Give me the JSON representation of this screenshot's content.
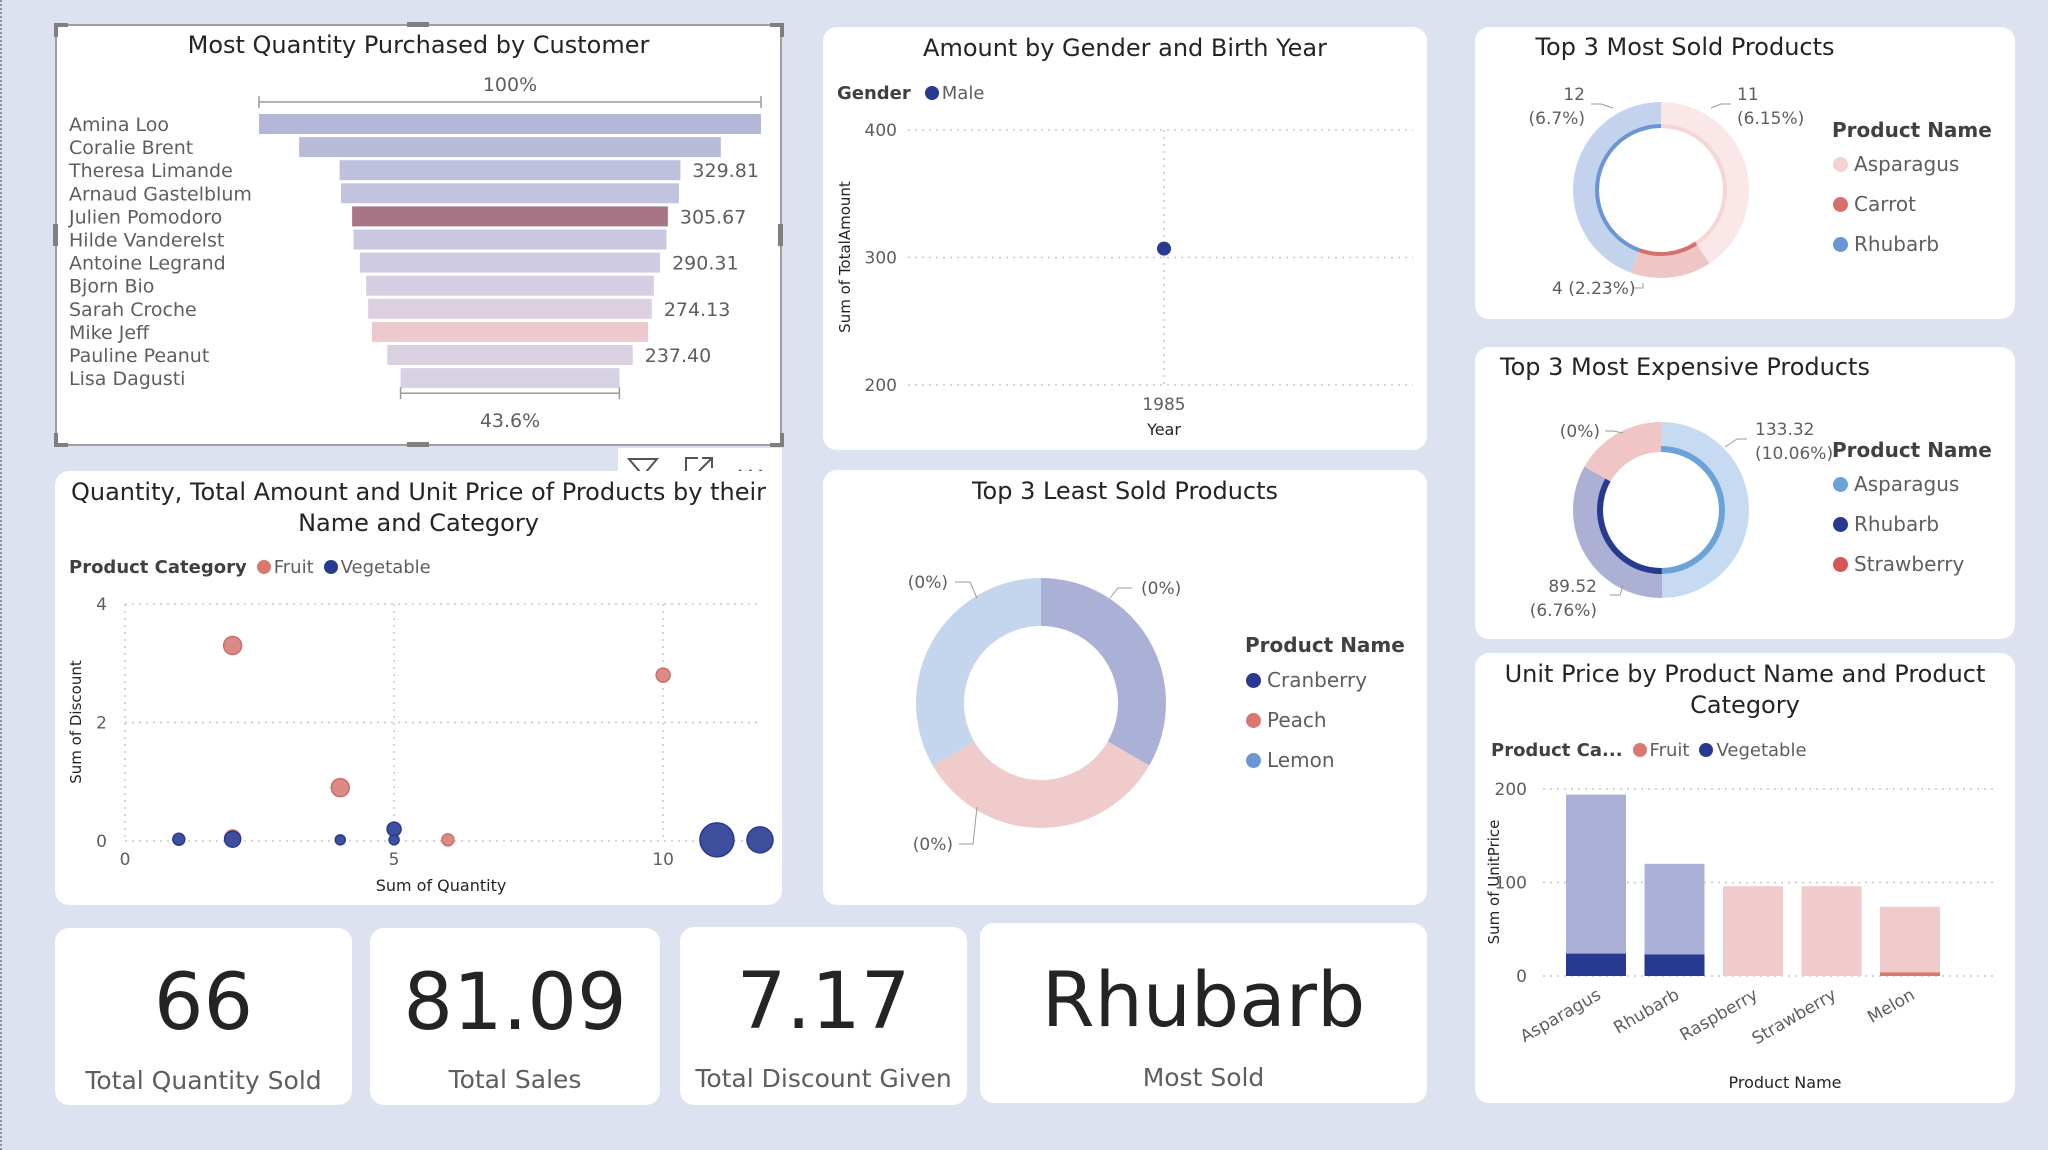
{
  "funnel": {
    "title": "Most Quantity Purchased by Customer",
    "top_pct": "100%",
    "bottom_pct": "43.6%",
    "customers": [
      {
        "name": "Amina Loo",
        "value": 100,
        "label": "",
        "color": "#b5b7d8"
      },
      {
        "name": "Coralie Brent",
        "value": 84,
        "label": "",
        "color": "#b9bbdb"
      },
      {
        "name": "Theresa Limande",
        "value": 67.9,
        "label": "329.81",
        "color": "#bec0dd"
      },
      {
        "name": "Arnaud Gastelblum",
        "value": 67.3,
        "label": "",
        "color": "#c2c3df"
      },
      {
        "name": "Julien Pomodoro",
        "value": 62.9,
        "label": "305.67",
        "color": "#a77586"
      },
      {
        "name": "Hilde Vanderelst",
        "value": 62.3,
        "label": "",
        "color": "#cac8e1"
      },
      {
        "name": "Antoine Legrand",
        "value": 59.8,
        "label": "290.31",
        "color": "#cfcbe2"
      },
      {
        "name": "Bjorn Bio",
        "value": 57.3,
        "label": "",
        "color": "#d5cde1"
      },
      {
        "name": "Sarah Croche",
        "value": 56.5,
        "label": "274.13",
        "color": "#dccfe0"
      },
      {
        "name": "Mike Jeff",
        "value": 55.0,
        "label": "",
        "color": "#ecc9cc"
      },
      {
        "name": "Pauline Peanut",
        "value": 48.9,
        "label": "237.40",
        "color": "#dad0e1"
      },
      {
        "name": "Lisa Dagusti",
        "value": 43.6,
        "label": "",
        "color": "#d6d1e3"
      }
    ]
  },
  "visual_toolbar": {
    "filter_icon": "filter-icon",
    "focus_icon": "focus-mode-icon",
    "more_icon": "more-options-icon",
    "more_text": "..."
  },
  "gender": {
    "title": "Amount by Gender and Birth Year",
    "legend_title": "Gender",
    "legend_items": [
      {
        "label": "Male",
        "color": "#273a90"
      }
    ],
    "chart_data": {
      "type": "scatter",
      "title": "Amount by Gender and Birth Year",
      "xlabel": "Year",
      "ylabel": "Sum of TotalAmount",
      "ylim": [
        200,
        400
      ],
      "y_ticks": [
        "400",
        "300",
        "200"
      ],
      "x_ticks": [
        "1985"
      ],
      "series": [
        {
          "name": "Male",
          "points": [
            {
              "x": 1985,
              "y": 307
            }
          ]
        }
      ]
    }
  },
  "top_sold": {
    "title": "Top 3 Most Sold Products",
    "legend_title": "Product Name",
    "legend_items": [
      {
        "label": "Asparagus",
        "color": "#f5d2d2"
      },
      {
        "label": "Carrot",
        "color": "#d6706d"
      },
      {
        "label": "Rhubarb",
        "color": "#6b96d6"
      }
    ],
    "chart_data": {
      "type": "pie",
      "slices": [
        {
          "name": "Asparagus",
          "value": 11,
          "label": [
            "11",
            "(6.15%)"
          ]
        },
        {
          "name": "Carrot",
          "value": 4,
          "label": [
            "4 (2.23%)"
          ]
        },
        {
          "name": "Rhubarb",
          "value": 12,
          "label": [
            "12",
            "(6.7%)"
          ]
        }
      ]
    }
  },
  "top_expensive": {
    "title": "Top 3 Most Expensive Products",
    "legend_title": "Product Name",
    "legend_items": [
      {
        "label": "Asparagus",
        "color": "#6ba3d8"
      },
      {
        "label": "Rhubarb",
        "color": "#273a90"
      },
      {
        "label": "Strawberry",
        "color": "#d65656"
      }
    ],
    "chart_data": {
      "type": "pie",
      "slices": [
        {
          "name": "Asparagus",
          "value": 133.32,
          "label": [
            "133.32",
            "(10.06%)"
          ]
        },
        {
          "name": "Rhubarb",
          "value": 89.52,
          "label": [
            "89.52",
            "(6.76%)"
          ]
        },
        {
          "name": "Strawberry",
          "value": 45,
          "label": [
            "(0%)"
          ]
        }
      ]
    }
  },
  "scatter": {
    "title_line1": "Quantity, Total Amount and Unit Price of Products by their",
    "title_line2": "Name and Category",
    "legend_title": "Product Category",
    "legend_items": [
      {
        "label": "Fruit",
        "color": "#d8786f"
      },
      {
        "label": "Vegetable",
        "color": "#273a90"
      }
    ],
    "chart_data": {
      "type": "scatter",
      "xlabel": "Sum of Quantity",
      "ylabel": "Sum of Discount",
      "xlim": [
        0,
        11.8
      ],
      "ylim": [
        0,
        4
      ],
      "x_ticks": [
        "0",
        "5",
        "10"
      ],
      "y_ticks": [
        "4",
        "2",
        "0"
      ],
      "series": [
        {
          "name": "Fruit",
          "points": [
            {
              "x": 2,
              "y": 3.3,
              "size": 9
            },
            {
              "x": 4,
              "y": 0.9,
              "size": 9
            },
            {
              "x": 10,
              "y": 2.8,
              "size": 7
            },
            {
              "x": 2,
              "y": 0.05,
              "size": 8
            },
            {
              "x": 6,
              "y": 0.02,
              "size": 6
            }
          ]
        },
        {
          "name": "Vegetable",
          "points": [
            {
              "x": 1,
              "y": 0.03,
              "size": 6
            },
            {
              "x": 2,
              "y": 0.03,
              "size": 8
            },
            {
              "x": 4,
              "y": 0.02,
              "size": 5
            },
            {
              "x": 5,
              "y": 0.2,
              "size": 7
            },
            {
              "x": 5,
              "y": 0.02,
              "size": 5
            },
            {
              "x": 11,
              "y": 0.02,
              "size": 17
            },
            {
              "x": 11.8,
              "y": 0.02,
              "size": 13
            }
          ]
        }
      ]
    }
  },
  "least_sold": {
    "title": "Top 3 Least Sold Products",
    "legend_title": "Product Name",
    "legend_items": [
      {
        "label": "Cranberry",
        "color": "#273a90"
      },
      {
        "label": "Peach",
        "color": "#d8786f"
      },
      {
        "label": "Lemon",
        "color": "#6b96d6"
      }
    ],
    "chart_data": {
      "type": "pie",
      "slices": [
        {
          "name": "Cranberry",
          "value": 1,
          "label": [
            "(0%)"
          ]
        },
        {
          "name": "Peach",
          "value": 1,
          "label": [
            "(0%)"
          ]
        },
        {
          "name": "Lemon",
          "value": 1,
          "label": [
            "(0%)"
          ]
        }
      ]
    }
  },
  "unit_price": {
    "title_line1": "Unit Price by Product Name and Product",
    "title_line2": "Category",
    "legend_title": "Product Ca...",
    "legend_items": [
      {
        "label": "Fruit",
        "color": "#d8786f"
      },
      {
        "label": "Vegetable",
        "color": "#273a90"
      }
    ],
    "chart_data": {
      "type": "bar",
      "xlabel": "Product Name",
      "ylabel": "Sum of UnitPrice",
      "ylim": [
        0,
        200
      ],
      "y_ticks": [
        "200",
        "100",
        "0"
      ],
      "categories": [
        "Asparagus",
        "Rhubarb",
        "Raspberry",
        "Strawberry",
        "Melon"
      ],
      "series": [
        {
          "name": "Vegetable",
          "values": [
            24,
            23,
            0,
            0,
            0
          ]
        },
        {
          "name": "Fruit",
          "values": [
            0,
            0,
            0,
            0,
            4
          ]
        },
        {
          "name": "Vegetable (light)",
          "values": [
            170,
            97,
            0,
            0,
            0
          ]
        },
        {
          "name": "Fruit (light)",
          "values": [
            0,
            0,
            96,
            96,
            70
          ]
        }
      ]
    }
  },
  "kpis": [
    {
      "value": "66",
      "label": "Total Quantity Sold"
    },
    {
      "value": "81.09",
      "label": "Total Sales"
    },
    {
      "value": "7.17",
      "label": "Total Discount Given"
    },
    {
      "value": "Rhubarb",
      "label": "Most Sold"
    }
  ]
}
